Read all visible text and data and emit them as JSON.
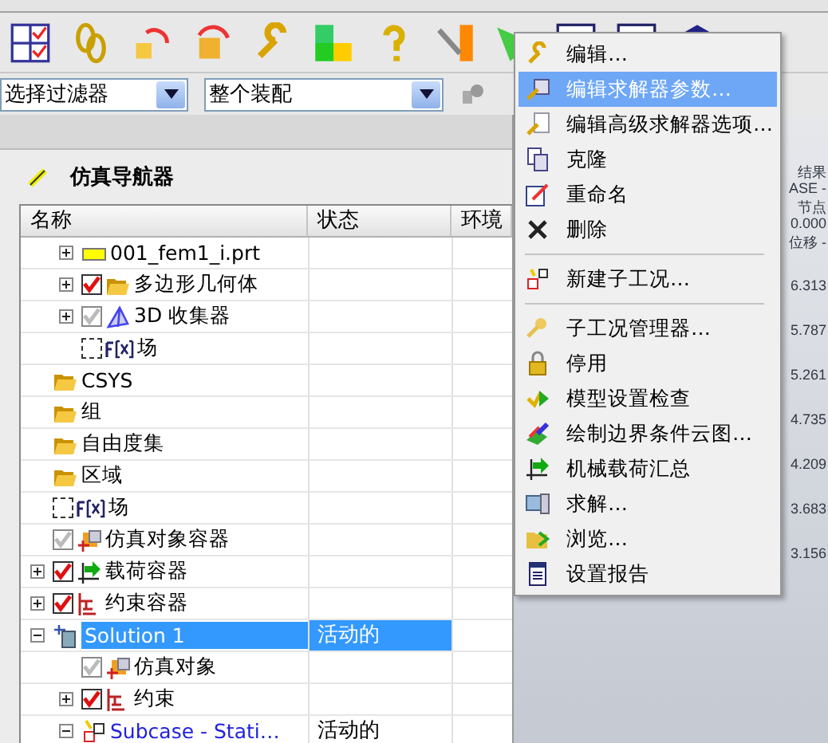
{
  "filter_bar": {
    "selection_filter": "选择过滤器",
    "assembly_scope": "整个装配"
  },
  "navigator": {
    "title": "仿真导航器",
    "columns": [
      "名称",
      "状态",
      "环境"
    ],
    "continued_rows": [
      {
        "label": "001_fem1_i.prt",
        "kind": "part",
        "expanded": false
      },
      {
        "label": "多边形几何体",
        "kind": "folder",
        "checked": true,
        "dimmed": false,
        "expanded": false
      },
      {
        "label": "3D 收集器",
        "kind": "collector",
        "checked": true,
        "dimmed": true,
        "expanded": false
      },
      {
        "label": "场",
        "kind": "field",
        "checked": false,
        "dimmed": false
      }
    ],
    "rows": [
      {
        "label": "CSYS",
        "kind": "folder"
      },
      {
        "label": "组",
        "kind": "folder"
      },
      {
        "label": "自由度集",
        "kind": "folder"
      },
      {
        "label": "区域",
        "kind": "folder"
      },
      {
        "label": "场",
        "kind": "field",
        "checked": false,
        "dimmed": false
      },
      {
        "label": "仿真对象容器",
        "kind": "sim-object",
        "checked": true,
        "dimmed": true
      },
      {
        "label": "载荷容器",
        "kind": "load",
        "checked": true,
        "dimmed": false,
        "expanded": false
      },
      {
        "label": "约束容器",
        "kind": "constraint",
        "checked": true,
        "dimmed": false,
        "expanded": false
      },
      {
        "label": "Solution 1",
        "kind": "solution",
        "status": "活动的",
        "selected": true,
        "expanded": true,
        "children": [
          {
            "label": "仿真对象",
            "kind": "sim-object",
            "checked": true,
            "dimmed": true
          },
          {
            "label": "约束",
            "kind": "constraint",
            "checked": true,
            "dimmed": false,
            "expanded": false
          },
          {
            "label": "Subcase - Stati…",
            "kind": "subcase",
            "status": "活动的",
            "expanded": true,
            "highlighted": true
          }
        ]
      }
    ]
  },
  "viewport_legend": [
    "结果",
    "ASE -",
    "节点",
    "0.000",
    "位移 -",
    "6.313",
    "5.787",
    "5.261",
    "4.735",
    "4.209",
    "3.683",
    "3.156"
  ],
  "context_menu": {
    "groups": [
      [
        {
          "label": "编辑…",
          "selected": false
        },
        {
          "label": "编辑求解器参数…",
          "selected": true
        },
        {
          "label": "编辑高级求解器选项…",
          "selected": false
        },
        {
          "label": "克隆",
          "selected": false
        },
        {
          "label": "重命名",
          "selected": false
        },
        {
          "label": "删除",
          "selected": false
        }
      ],
      [
        {
          "label": "新建子工况…",
          "selected": false
        }
      ],
      [
        {
          "label": "子工况管理器…",
          "selected": false
        },
        {
          "label": "停用",
          "selected": false
        },
        {
          "label": "模型设置检查",
          "selected": false
        },
        {
          "label": "绘制边界条件云图…",
          "selected": false
        },
        {
          "label": "机械载荷汇总",
          "selected": false
        },
        {
          "label": "求解…",
          "selected": false
        },
        {
          "label": "浏览…",
          "selected": false
        },
        {
          "label": "设置报告",
          "selected": false
        }
      ]
    ]
  }
}
